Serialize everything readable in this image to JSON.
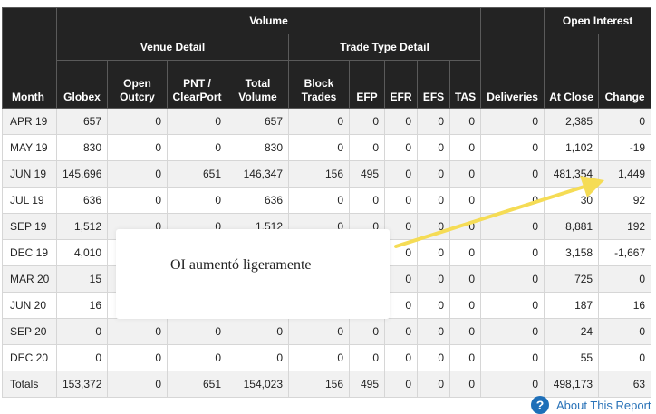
{
  "headers": {
    "month": "Month",
    "volume": "Volume",
    "venue_detail": "Venue Detail",
    "trade_type_detail": "Trade Type Detail",
    "open_interest": "Open Interest",
    "globex": "Globex",
    "open_outcry": "Open Outcry",
    "pnt_clearport": "PNT / ClearPort",
    "total_volume": "Total Volume",
    "block_trades": "Block Trades",
    "efp": "EFP",
    "efr": "EFR",
    "efs": "EFS",
    "tas": "TAS",
    "deliveries": "Deliveries",
    "at_close": "At Close",
    "change": "Change"
  },
  "rows": [
    {
      "month": "APR 19",
      "globex": "657",
      "open_outcry": "0",
      "pnt": "0",
      "total": "657",
      "block": "0",
      "efp": "0",
      "efr": "0",
      "efs": "0",
      "tas": "0",
      "deliveries": "0",
      "at_close": "2,385",
      "change": "0"
    },
    {
      "month": "MAY 19",
      "globex": "830",
      "open_outcry": "0",
      "pnt": "0",
      "total": "830",
      "block": "0",
      "efp": "0",
      "efr": "0",
      "efs": "0",
      "tas": "0",
      "deliveries": "0",
      "at_close": "1,102",
      "change": "-19"
    },
    {
      "month": "JUN 19",
      "globex": "145,696",
      "open_outcry": "0",
      "pnt": "651",
      "total": "146,347",
      "block": "156",
      "efp": "495",
      "efr": "0",
      "efs": "0",
      "tas": "0",
      "deliveries": "0",
      "at_close": "481,354",
      "change": "1,449"
    },
    {
      "month": "JUL 19",
      "globex": "636",
      "open_outcry": "0",
      "pnt": "0",
      "total": "636",
      "block": "0",
      "efp": "0",
      "efr": "0",
      "efs": "0",
      "tas": "0",
      "deliveries": "0",
      "at_close": "30",
      "change": "92"
    },
    {
      "month": "SEP 19",
      "globex": "1,512",
      "open_outcry": "0",
      "pnt": "0",
      "total": "1,512",
      "block": "0",
      "efp": "0",
      "efr": "0",
      "efs": "0",
      "tas": "0",
      "deliveries": "0",
      "at_close": "8,881",
      "change": "192"
    },
    {
      "month": "DEC 19",
      "globex": "4,010",
      "open_outcry": "",
      "pnt": "",
      "total": "",
      "block": "",
      "efp": "",
      "efr": "0",
      "efs": "0",
      "tas": "0",
      "deliveries": "0",
      "at_close": "3,158",
      "change": "-1,667"
    },
    {
      "month": "MAR 20",
      "globex": "15",
      "open_outcry": "",
      "pnt": "",
      "total": "",
      "block": "",
      "efp": "",
      "efr": "0",
      "efs": "0",
      "tas": "0",
      "deliveries": "0",
      "at_close": "725",
      "change": "0"
    },
    {
      "month": "JUN 20",
      "globex": "16",
      "open_outcry": "",
      "pnt": "",
      "total": "",
      "block": "",
      "efp": "",
      "efr": "0",
      "efs": "0",
      "tas": "0",
      "deliveries": "0",
      "at_close": "187",
      "change": "16"
    },
    {
      "month": "SEP 20",
      "globex": "0",
      "open_outcry": "0",
      "pnt": "0",
      "total": "0",
      "block": "0",
      "efp": "0",
      "efr": "0",
      "efs": "0",
      "tas": "0",
      "deliveries": "0",
      "at_close": "24",
      "change": "0"
    },
    {
      "month": "DEC 20",
      "globex": "0",
      "open_outcry": "0",
      "pnt": "0",
      "total": "0",
      "block": "0",
      "efp": "0",
      "efr": "0",
      "efs": "0",
      "tas": "0",
      "deliveries": "0",
      "at_close": "55",
      "change": "0"
    }
  ],
  "totals": {
    "label": "Totals",
    "globex": "153,372",
    "open_outcry": "0",
    "pnt": "651",
    "total": "154,023",
    "block": "156",
    "efp": "495",
    "efr": "0",
    "efs": "0",
    "tas": "0",
    "deliveries": "0",
    "at_close": "498,173",
    "change": "63"
  },
  "annotation": {
    "text": "OI aumentó ligeramente",
    "arrow_color": "#f5dc55"
  },
  "footer": {
    "help_icon_glyph": "?",
    "link_label": "About This Report"
  },
  "colors": {
    "header_bg": "#232323",
    "stripe": "#f1f1f1",
    "link": "#2a73b8"
  }
}
